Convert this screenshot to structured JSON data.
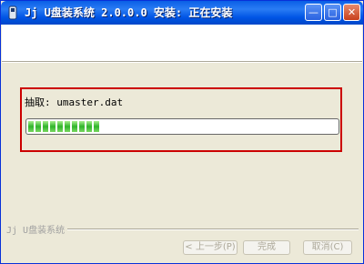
{
  "window": {
    "title": "Jj U盘装系统 2.0.0.0 安装: 正在安装",
    "controls": {
      "minimize": "—",
      "maximize": "□",
      "close": "✕"
    }
  },
  "extract": {
    "label": "抽取: umaster.dat",
    "progress_fraction": 0.24
  },
  "footer": {
    "brand": "Jj U盘装系统",
    "back_label": "< 上一步(P)",
    "finish_label": "完成",
    "cancel_label": "取消(C)"
  },
  "colors": {
    "titlebar": "#0055e5",
    "highlight": "#cc0000",
    "progress": "#2fb42a"
  }
}
